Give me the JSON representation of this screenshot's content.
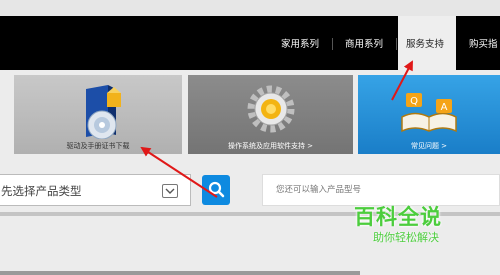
{
  "nav": {
    "items": [
      "家用系列",
      "商用系列",
      "服务支持",
      "购买指"
    ],
    "active_index": 2
  },
  "tiles": [
    {
      "caption": "驱动及手册证书下载",
      "icon": "driver-cd-box-icon"
    },
    {
      "caption": "操作系统及应用软件支持 >",
      "icon": "gear-icon"
    },
    {
      "caption": "常见问题 >",
      "icon": "qa-book-icon"
    }
  ],
  "search": {
    "product_type_value": "先选择产品类型",
    "query_placeholder": "您还可以输入产品型号"
  },
  "watermark": {
    "title": "百科全说",
    "subtitle": "助你轻松解决"
  },
  "colors": {
    "nav_background": "#000000",
    "search_button": "#0e8ae0",
    "faq_tile": "#1a7ec8",
    "annotation_arrow": "#e01818",
    "watermark": "#4ccd3d"
  }
}
